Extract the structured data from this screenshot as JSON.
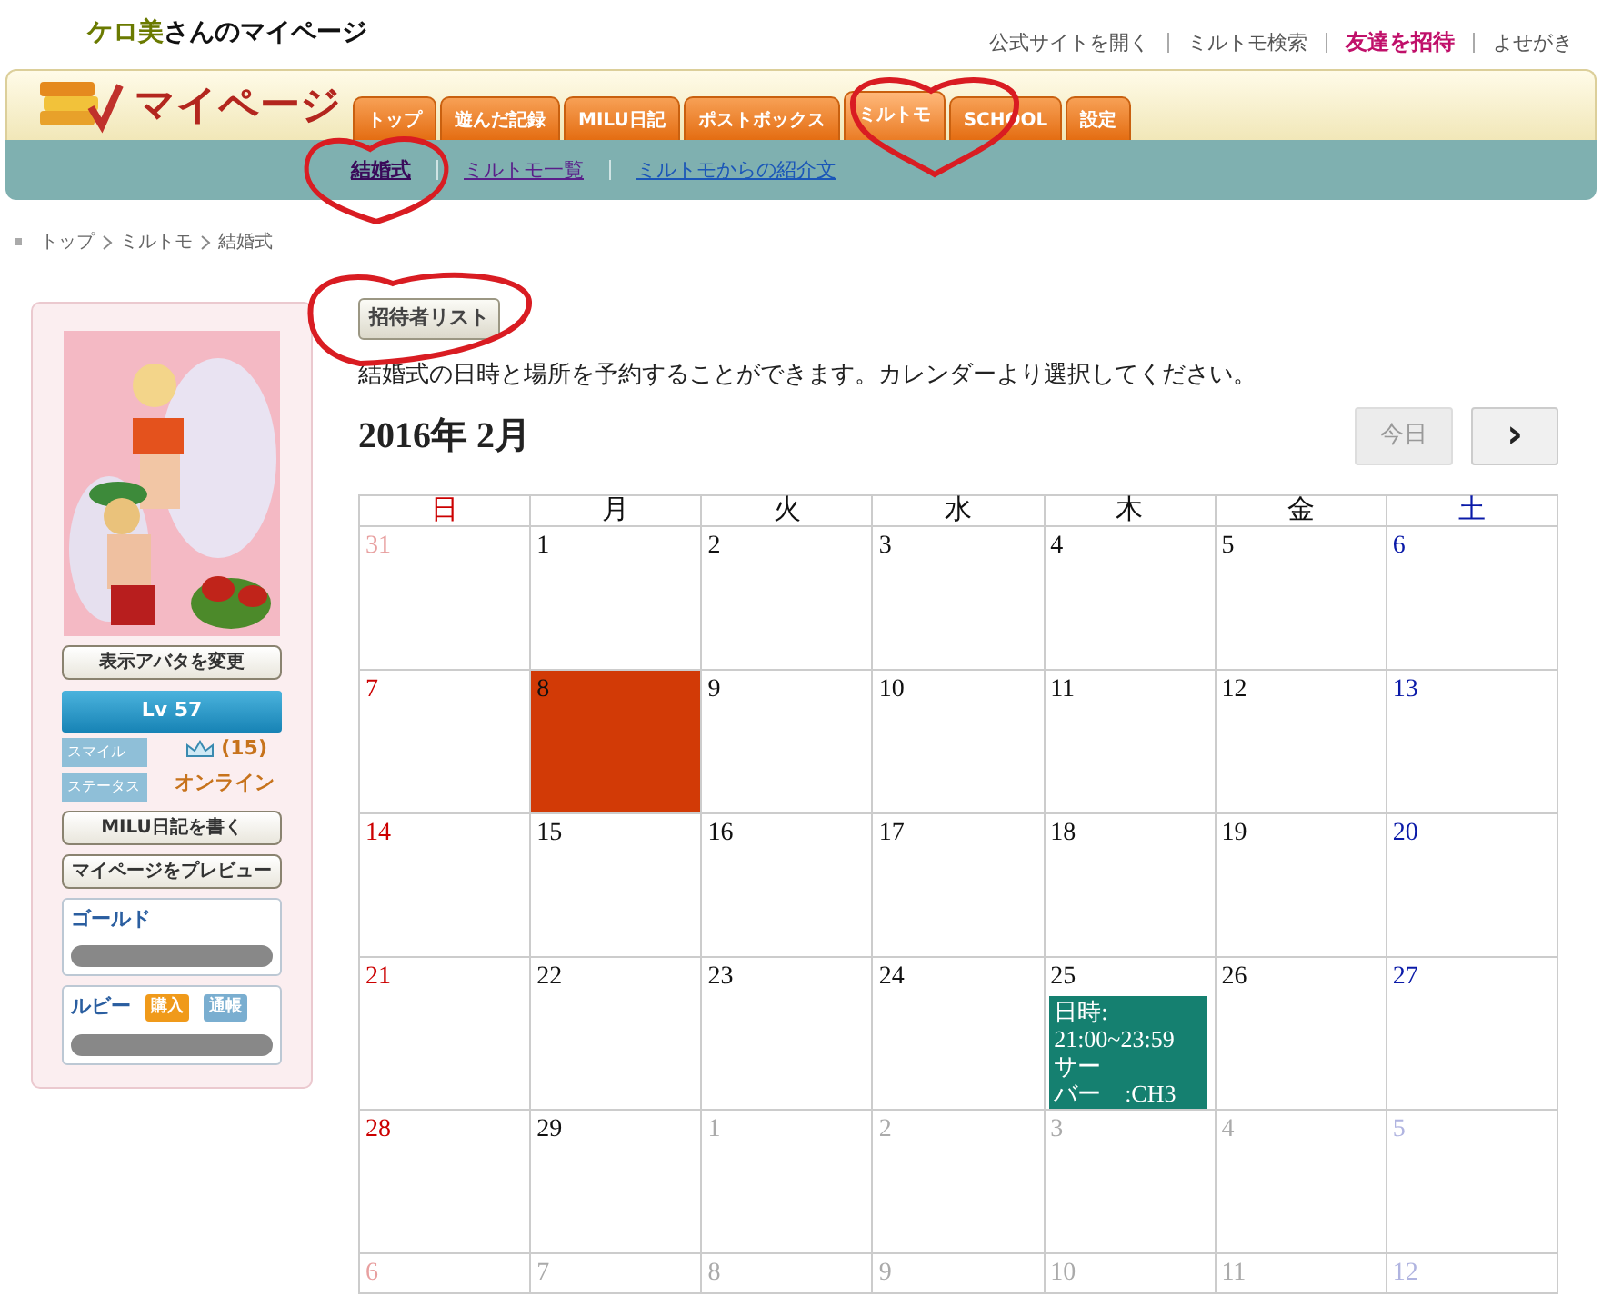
{
  "header": {
    "user_name": "ケロ美",
    "title_suffix": "さんのマイページ",
    "links": [
      {
        "label": "公式サイトを開く",
        "highlight": false
      },
      {
        "label": "ミルトモ検索",
        "highlight": false
      },
      {
        "label": "友達を招待",
        "highlight": true
      },
      {
        "label": "よせがき",
        "highlight": false
      }
    ]
  },
  "nav": {
    "logo_text": "マイページ",
    "tabs": [
      {
        "label": "トップ",
        "selected": false
      },
      {
        "label": "遊んだ記録",
        "selected": false
      },
      {
        "label": "MILU日記",
        "selected": false
      },
      {
        "label": "ポストボックス",
        "selected": false
      },
      {
        "label": "ミルトモ",
        "selected": true
      },
      {
        "label": "SCHOOL",
        "selected": false
      },
      {
        "label": "設定",
        "selected": false
      }
    ],
    "subtabs": [
      {
        "label": "結婚式",
        "selected": true,
        "visited": true
      },
      {
        "label": "ミルトモ一覧",
        "selected": false,
        "visited": true
      },
      {
        "label": "ミルトモからの紹介文",
        "selected": false,
        "visited": false
      }
    ]
  },
  "breadcrumb": [
    "トップ",
    "ミルトモ",
    "結婚式"
  ],
  "sidebar": {
    "change_avatar_button": "表示アバタを変更",
    "level": "Lv 57",
    "smile_label": "スマイル",
    "smile_value": "(15)",
    "status_label": "ステータス",
    "status_value": "オンライン",
    "diary_button": "MILU日記を書く",
    "preview_button": "マイページをプレビュー",
    "gold_title": "ゴールド",
    "ruby_title": "ルビー",
    "buy_button": "購入",
    "passbook_button": "通帳"
  },
  "main": {
    "invite_button": "招待者リスト",
    "description": "結婚式の日時と場所を予約することができます。カレンダーより選択してください。",
    "month_title": "2016年 2月",
    "today_button": {
      "label": "今日",
      "disabled": true
    },
    "next_button": "›",
    "calendar": {
      "weekdays": [
        "日",
        "月",
        "火",
        "水",
        "木",
        "金",
        "土"
      ],
      "weeks": [
        [
          {
            "day": "31",
            "other_month": true,
            "selected": false
          },
          {
            "day": "1",
            "other_month": false,
            "selected": false
          },
          {
            "day": "2",
            "other_month": false,
            "selected": false
          },
          {
            "day": "3",
            "other_month": false,
            "selected": false
          },
          {
            "day": "4",
            "other_month": false,
            "selected": false
          },
          {
            "day": "5",
            "other_month": false,
            "selected": false
          },
          {
            "day": "6",
            "other_month": false,
            "selected": false
          }
        ],
        [
          {
            "day": "7",
            "other_month": false,
            "selected": false
          },
          {
            "day": "8",
            "other_month": false,
            "selected": true
          },
          {
            "day": "9",
            "other_month": false,
            "selected": false
          },
          {
            "day": "10",
            "other_month": false,
            "selected": false
          },
          {
            "day": "11",
            "other_month": false,
            "selected": false
          },
          {
            "day": "12",
            "other_month": false,
            "selected": false
          },
          {
            "day": "13",
            "other_month": false,
            "selected": false
          }
        ],
        [
          {
            "day": "14",
            "other_month": false,
            "selected": false
          },
          {
            "day": "15",
            "other_month": false,
            "selected": false
          },
          {
            "day": "16",
            "other_month": false,
            "selected": false
          },
          {
            "day": "17",
            "other_month": false,
            "selected": false
          },
          {
            "day": "18",
            "other_month": false,
            "selected": false
          },
          {
            "day": "19",
            "other_month": false,
            "selected": false
          },
          {
            "day": "20",
            "other_month": false,
            "selected": false
          }
        ],
        [
          {
            "day": "21",
            "other_month": false,
            "selected": false
          },
          {
            "day": "22",
            "other_month": false,
            "selected": false
          },
          {
            "day": "23",
            "other_month": false,
            "selected": false
          },
          {
            "day": "24",
            "other_month": false,
            "selected": false
          },
          {
            "day": "25",
            "other_month": false,
            "selected": false,
            "event": [
              "日時:",
              "21:00~23:59",
              "サー",
              "バー　:CH3"
            ]
          },
          {
            "day": "26",
            "other_month": false,
            "selected": false
          },
          {
            "day": "27",
            "other_month": false,
            "selected": false
          }
        ],
        [
          {
            "day": "28",
            "other_month": false,
            "selected": false
          },
          {
            "day": "29",
            "other_month": false,
            "selected": false
          },
          {
            "day": "1",
            "other_month": true,
            "selected": false
          },
          {
            "day": "2",
            "other_month": true,
            "selected": false
          },
          {
            "day": "3",
            "other_month": true,
            "selected": false
          },
          {
            "day": "4",
            "other_month": true,
            "selected": false
          },
          {
            "day": "5",
            "other_month": true,
            "selected": false
          }
        ],
        [
          {
            "day": "6",
            "other_month": true,
            "selected": false
          },
          {
            "day": "7",
            "other_month": true,
            "selected": false
          },
          {
            "day": "8",
            "other_month": true,
            "selected": false
          },
          {
            "day": "9",
            "other_month": true,
            "selected": false
          },
          {
            "day": "10",
            "other_month": true,
            "selected": false
          },
          {
            "day": "11",
            "other_month": true,
            "selected": false
          },
          {
            "day": "12",
            "other_month": true,
            "selected": false
          }
        ]
      ]
    }
  }
}
